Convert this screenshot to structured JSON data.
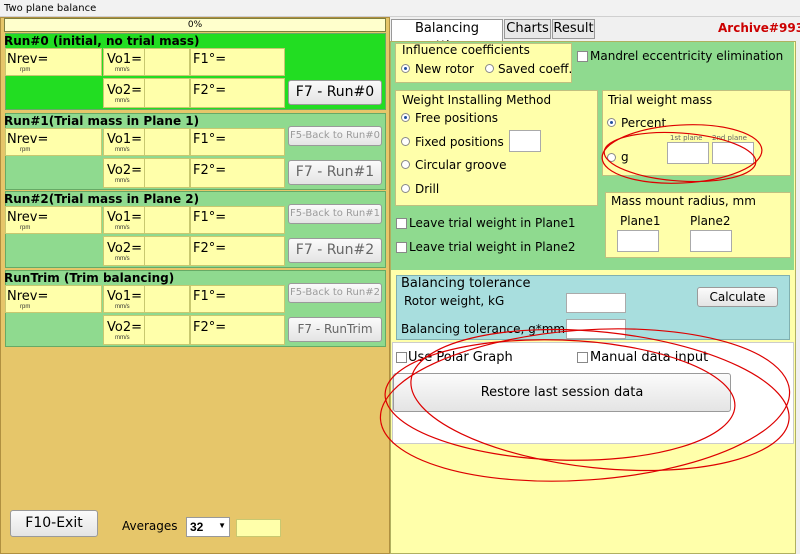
{
  "window": {
    "title": "Two plane balance"
  },
  "progress": {
    "text": "0%"
  },
  "runs": [
    {
      "title": "Run#0 (initial, no trial mass)",
      "back": "",
      "run": "F7 - Run#0"
    },
    {
      "title": "Run#1(Trial mass in Plane 1)",
      "back": "F5-Back to Run#0",
      "run": "F7 - Run#1"
    },
    {
      "title": "Run#2(Trial mass in Plane 2)",
      "back": "F5-Back to Run#1",
      "run": "F7 - Run#2"
    },
    {
      "title": "RunTrim (Trim balancing)",
      "back": "F5-Back to Run#2",
      "run": "F7 - RunTrim"
    }
  ],
  "labels": {
    "nrev": "Nrev=",
    "rpm": "rpm",
    "vo1": "Vo1=",
    "vo2": "Vo2=",
    "mms": "mm/s",
    "f1": "F1°=",
    "f2": "F2°="
  },
  "bottom": {
    "exit": "F10-Exit",
    "averages_label": "Averages",
    "averages_value": "32"
  },
  "tabs": [
    "Balancing settings",
    "Charts",
    "Result"
  ],
  "archive": "Archive#993",
  "influence": {
    "title": "Influence coefficients",
    "new_rotor": "New rotor",
    "saved": "Saved coeff."
  },
  "mandrel": "Mandrel eccentricity elimination",
  "wim": {
    "title": "Weight Installing Method",
    "options": [
      "Free positions",
      "Fixed positions",
      "Circular groove",
      "Drill"
    ]
  },
  "trial": {
    "title": "Trial weight mass",
    "percent": "Percent",
    "g": "g",
    "p1": "1st plane",
    "p2": "2nd plane"
  },
  "mass_mount": {
    "title": "Mass mount radius, mm",
    "plane1": "Plane1",
    "plane2": "Plane2"
  },
  "leave1": "Leave trial weight in Plane1",
  "leave2": "Leave trial weight in Plane2",
  "tolerance": {
    "title": "Balancing tolerance",
    "rotor_weight": "Rotor weight, kG",
    "tol": "Balancing tolerance, g*mm",
    "calculate": "Calculate"
  },
  "polar": "Use Polar Graph",
  "manual": "Manual data input",
  "restore": "Restore last session data"
}
